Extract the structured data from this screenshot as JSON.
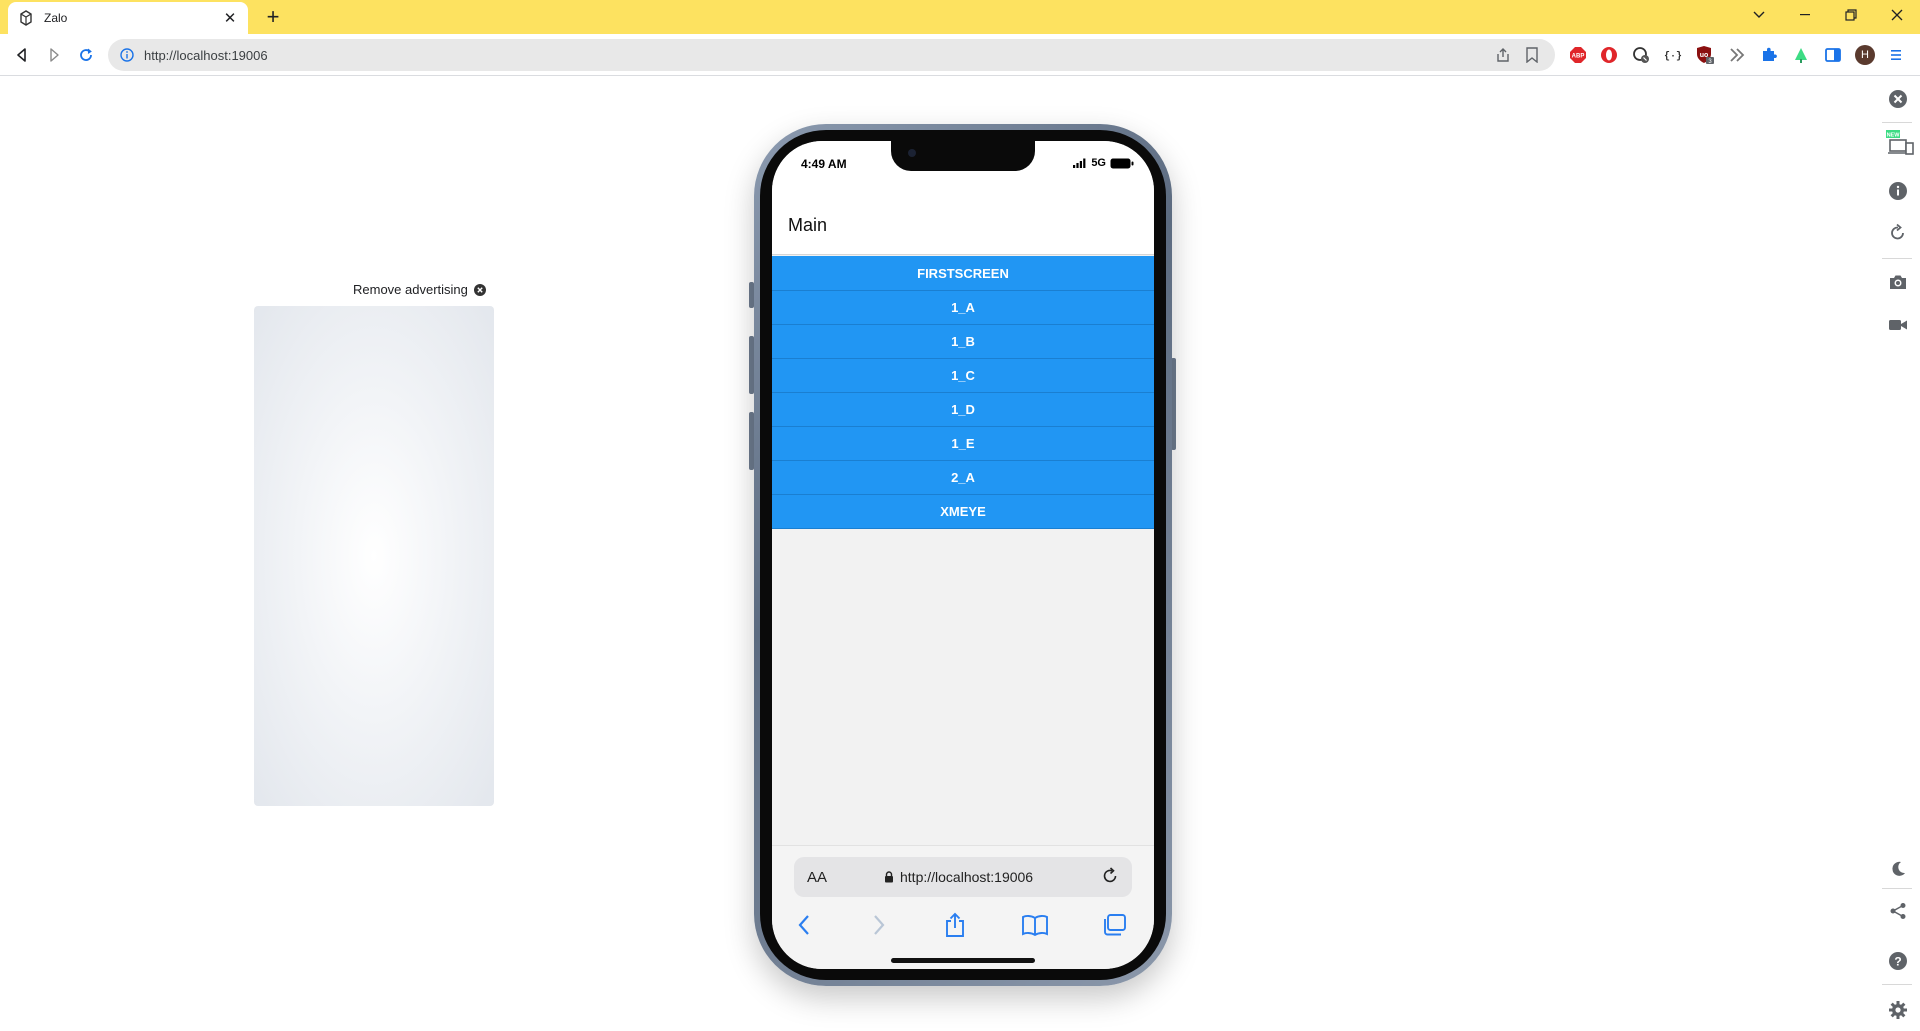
{
  "browser": {
    "tab_title": "Zalo",
    "url": "http://localhost:19006",
    "profile_initial": "H",
    "ext_badge": "3",
    "new_badge": "NEW"
  },
  "ad": {
    "remove_label": "Remove advertising"
  },
  "phone": {
    "time": "4:49 AM",
    "network": "5G",
    "header_title": "Main",
    "nav_items": [
      "FIRSTSCREEN",
      "1_A",
      "1_B",
      "1_C",
      "1_D",
      "1_E",
      "2_A",
      "XMEYE"
    ],
    "safari_aa": "AA",
    "safari_url": "http://localhost:19006"
  },
  "colors": {
    "tabbar": "#fde260",
    "nav_button": "#2196f3",
    "screen_bg": "#f2f2f2",
    "ios_blue": "#2a7ef0"
  }
}
